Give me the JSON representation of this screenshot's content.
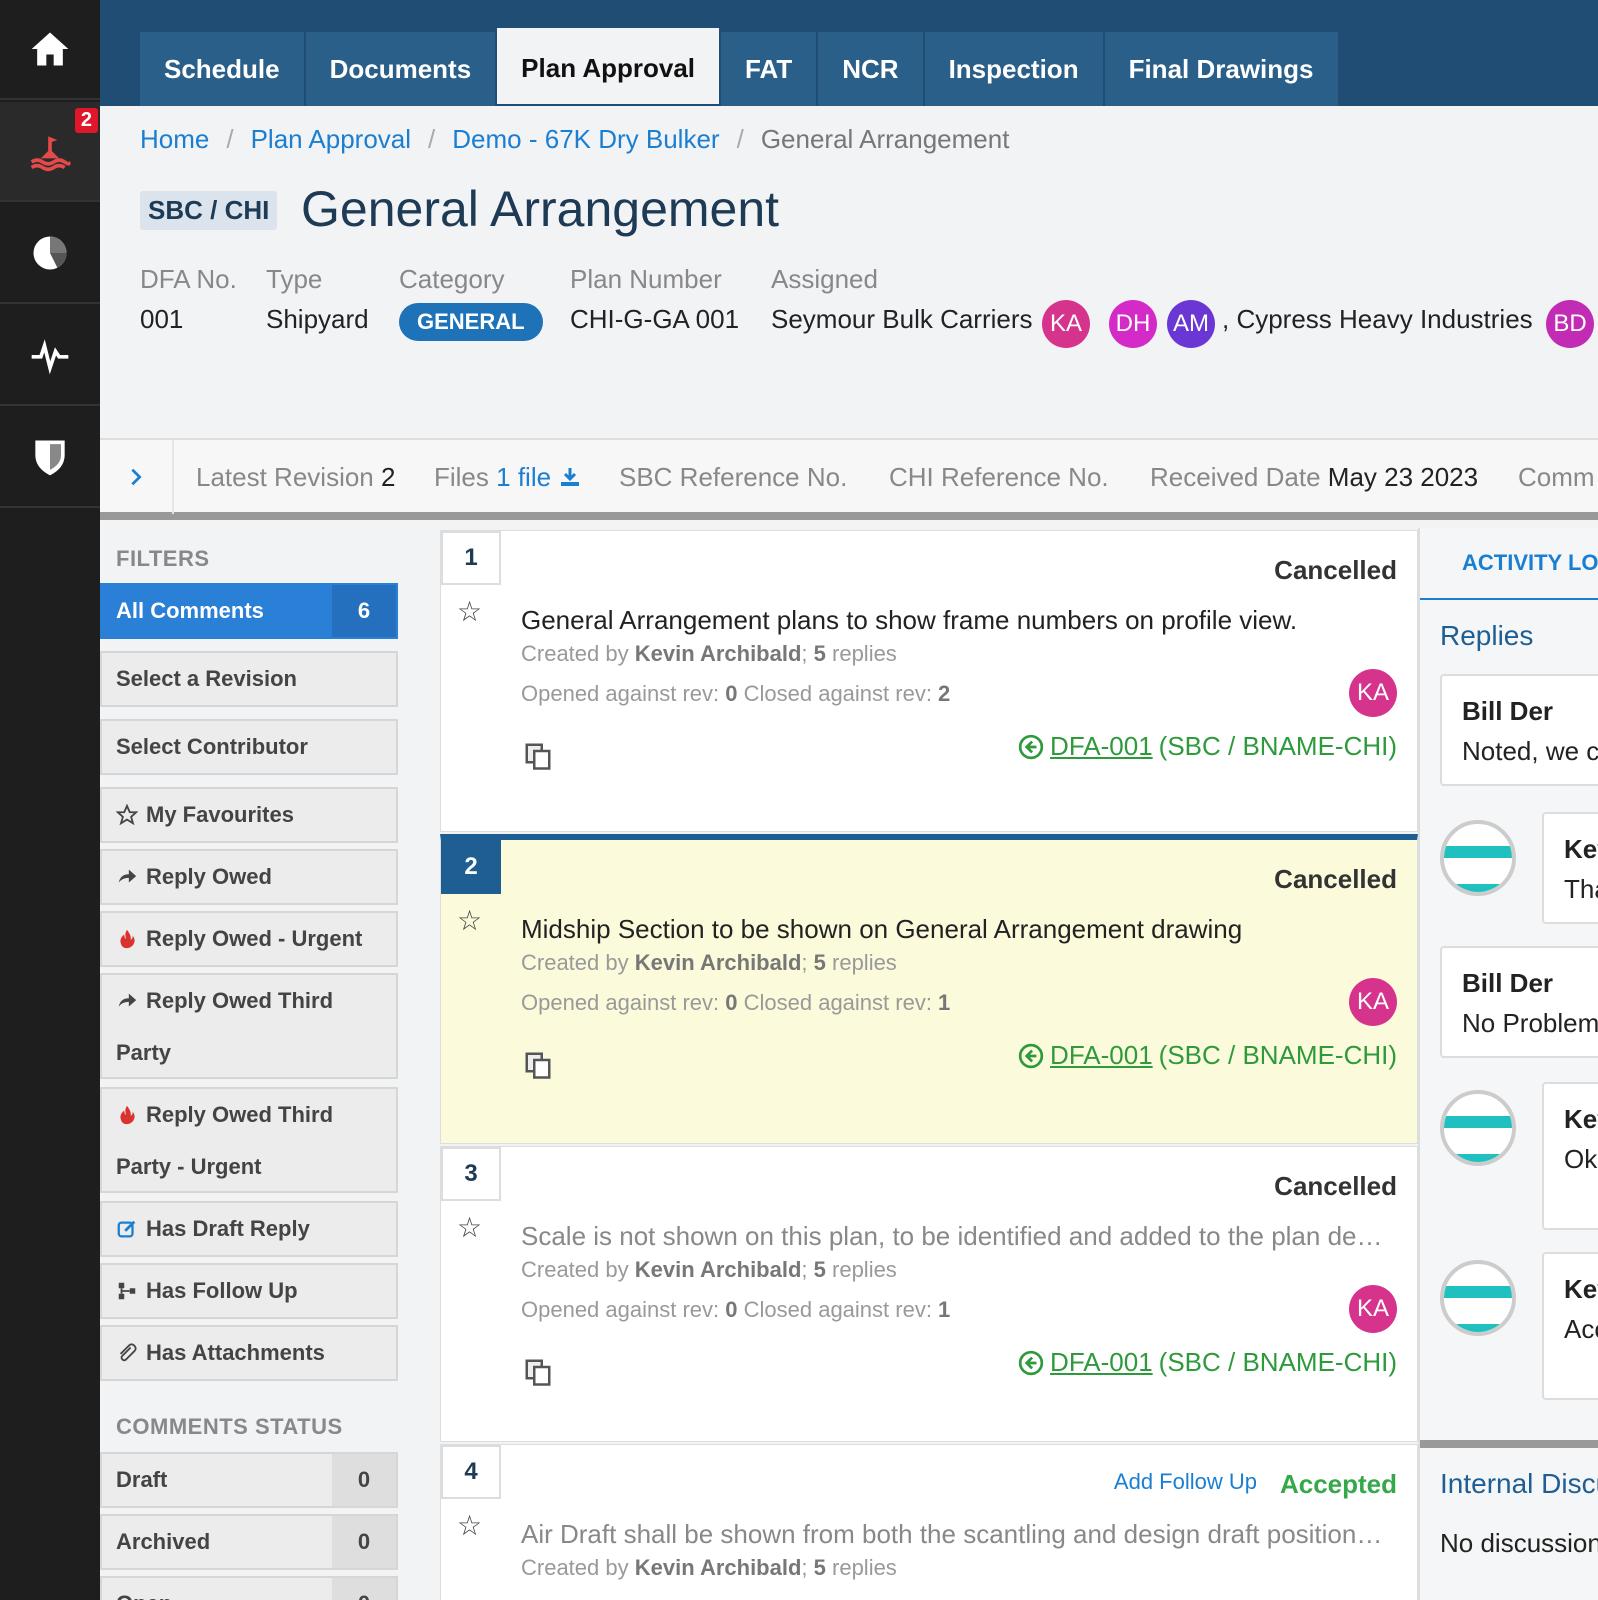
{
  "rail": {
    "badge": "2",
    "icons": [
      "home-icon",
      "buoy-icon",
      "chart-pie-icon",
      "activity-icon",
      "shield-icon"
    ]
  },
  "tabs": [
    "Schedule",
    "Documents",
    "Plan Approval",
    "FAT",
    "NCR",
    "Inspection",
    "Final Drawings"
  ],
  "active_tab": "Plan Approval",
  "breadcrumb": [
    "Home",
    "Plan Approval",
    "Demo - 67K Dry Bulker",
    "General Arrangement"
  ],
  "header": {
    "tag": "SBC / CHI",
    "title": "General Arrangement",
    "dfa_label": "DFA No.",
    "dfa_value": "001",
    "type_label": "Type",
    "type_value": "Shipyard",
    "category_label": "Category",
    "category_value": "GENERAL",
    "plan_label": "Plan Number",
    "plan_value": "CHI-G-GA 001",
    "assigned_label": "Assigned",
    "assigned_org1": "Seymour Bulk Carriers",
    "assigned_org2": ", Cypress Heavy Industries",
    "avatars": [
      "KA",
      "DH",
      "AM",
      "BD"
    ]
  },
  "colors": {
    "nav": "#1f4d74",
    "tab": "#2a5f89",
    "accent": "#2a7fd6",
    "link": "#1b7fd1",
    "success": "#35a84a",
    "highlight": "#fbfbdc"
  },
  "revision": {
    "latest_label": "Latest Revision",
    "latest_value": "2",
    "files_label": "Files",
    "files_value": "1 file",
    "sbc_ref": "SBC Reference No.",
    "chi_ref": "CHI Reference No.",
    "received_label": "Received Date",
    "received_value": "May 23 2023",
    "comm": "Comm"
  },
  "filters": {
    "title": "FILTERS",
    "all_label": "All Comments",
    "all_count": "6",
    "items": [
      "Select a Revision",
      "Select Contributor",
      "My Favourites",
      "Reply Owed",
      "Reply Owed - Urgent"
    ],
    "third_1": "Reply Owed Third",
    "third_2": "Party",
    "third_urgent_1": "Reply Owed Third",
    "third_urgent_2": "Party - Urgent",
    "more": [
      "Has Draft Reply",
      "Has Follow Up",
      "Has Attachments"
    ],
    "status_title": "COMMENTS STATUS",
    "status": [
      {
        "label": "Draft",
        "count": "0"
      },
      {
        "label": "Archived",
        "count": "0"
      },
      {
        "label": "Open",
        "count": "0"
      }
    ]
  },
  "comments": [
    {
      "num": "1",
      "status": "Cancelled",
      "title": "General Arrangement plans to show frame numbers on profile view.",
      "created_prefix": "Created by ",
      "author": "Kevin Archibald",
      "replies_sep": "; ",
      "replies": "5",
      "replies_suffix": " replies",
      "opened_prefix": "Opened against rev: ",
      "opened": "0",
      "closed_prefix": " Closed against rev: ",
      "closed": "2",
      "avatar": "KA",
      "ref_link": "DFA-001",
      "ref_rest": "(SBC / BNAME-CHI)"
    },
    {
      "num": "2",
      "status": "Cancelled",
      "title": "Midship Section to be shown on General Arrangement drawing",
      "created_prefix": "Created by ",
      "author": "Kevin Archibald",
      "replies_sep": "; ",
      "replies": "5",
      "replies_suffix": " replies",
      "opened_prefix": "Opened against rev: ",
      "opened": "0",
      "closed_prefix": " Closed against rev: ",
      "closed": "1",
      "avatar": "KA",
      "ref_link": "DFA-001",
      "ref_rest": "(SBC / BNAME-CHI)"
    },
    {
      "num": "3",
      "status": "Cancelled",
      "title": "Scale is not shown on this plan, to be identified and added to the plan de…",
      "created_prefix": "Created by ",
      "author": "Kevin Archibald",
      "replies_sep": "; ",
      "replies": "5",
      "replies_suffix": " replies",
      "opened_prefix": "Opened against rev: ",
      "opened": "0",
      "closed_prefix": " Closed against rev: ",
      "closed": "1",
      "avatar": "KA",
      "ref_link": "DFA-001",
      "ref_rest": "(SBC / BNAME-CHI)"
    },
    {
      "num": "4",
      "status": "Accepted",
      "follow_up": "Add Follow Up",
      "title": "Air Draft shall be shown from both the scantling and design draft position…",
      "created_prefix": "Created by ",
      "author": "Kevin Archibald",
      "replies_sep": "; ",
      "replies": "5",
      "replies_suffix": " replies"
    }
  ],
  "activity": {
    "tab": "ACTIVITY LO",
    "replies_title": "Replies",
    "entries": [
      {
        "name": "Bill Der",
        "text": "Noted, we c"
      },
      {
        "name": "Kev",
        "text": "Tha"
      },
      {
        "name": "Bill Der",
        "text": "No Problem"
      },
      {
        "name": "Kev",
        "text": "Ok."
      },
      {
        "name": "Kev",
        "text": "Acc"
      }
    ],
    "internal_title": "Internal Discu",
    "internal_text": "No discussion"
  }
}
